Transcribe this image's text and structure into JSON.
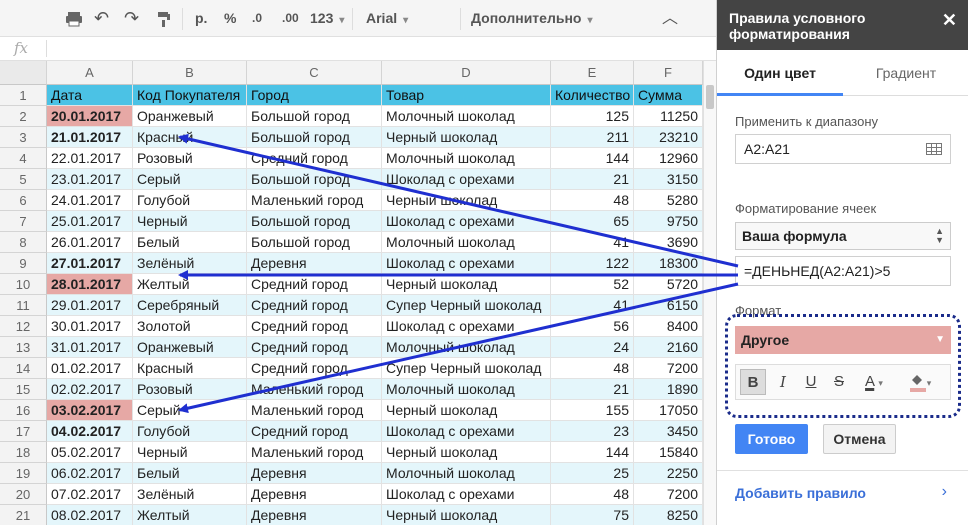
{
  "toolbar": {
    "currency": "р.",
    "percent": "%",
    "dec_less": ".0",
    "dec_more": ".00",
    "number_format": "123",
    "font": "Arial",
    "more": "Дополнительно"
  },
  "formula_bar": {
    "fx": "fx"
  },
  "columns": [
    "A",
    "B",
    "C",
    "D",
    "E",
    "F"
  ],
  "rows": [
    {
      "n": "1",
      "c": [
        "Дата",
        "Код Покупателя",
        "Город",
        "Товар",
        "Количество",
        "Сумма"
      ]
    },
    {
      "n": "2",
      "c": [
        "20.01.2017",
        "Оранжевый",
        "Большой город",
        "Молочный шоколад",
        "125",
        "11250"
      ],
      "hl": true
    },
    {
      "n": "3",
      "c": [
        "21.01.2017",
        "Красный",
        "Большой город",
        "Черный шоколад",
        "211",
        "23210"
      ],
      "hl": true
    },
    {
      "n": "4",
      "c": [
        "22.01.2017",
        "Розовый",
        "Средний город",
        "Молочный шоколад",
        "144",
        "12960"
      ]
    },
    {
      "n": "5",
      "c": [
        "23.01.2017",
        "Серый",
        "Большой город",
        "Шоколад с орехами",
        "21",
        "3150"
      ]
    },
    {
      "n": "6",
      "c": [
        "24.01.2017",
        "Голубой",
        "Маленький город",
        "Черный шоколад",
        "48",
        "5280"
      ]
    },
    {
      "n": "7",
      "c": [
        "25.01.2017",
        "Черный",
        "Большой город",
        "Шоколад с орехами",
        "65",
        "9750"
      ]
    },
    {
      "n": "8",
      "c": [
        "26.01.2017",
        "Белый",
        "Большой город",
        "Молочный шоколад",
        "41",
        "3690"
      ]
    },
    {
      "n": "9",
      "c": [
        "27.01.2017",
        "Зелёный",
        "Деревня",
        "Шоколад с орехами",
        "122",
        "18300"
      ],
      "hl": true
    },
    {
      "n": "10",
      "c": [
        "28.01.2017",
        "Желтый",
        "Средний город",
        "Черный шоколад",
        "52",
        "5720"
      ],
      "hl": true
    },
    {
      "n": "11",
      "c": [
        "29.01.2017",
        "Серебряный",
        "Средний город",
        "Супер Черный шоколад",
        "41",
        "6150"
      ]
    },
    {
      "n": "12",
      "c": [
        "30.01.2017",
        "Золотой",
        "Средний город",
        "Шоколад с орехами",
        "56",
        "8400"
      ]
    },
    {
      "n": "13",
      "c": [
        "31.01.2017",
        "Оранжевый",
        "Средний город",
        "Молочный шоколад",
        "24",
        "2160"
      ]
    },
    {
      "n": "14",
      "c": [
        "01.02.2017",
        "Красный",
        "Средний город",
        "Супер Черный шоколад",
        "48",
        "7200"
      ]
    },
    {
      "n": "15",
      "c": [
        "02.02.2017",
        "Розовый",
        "Маленький город",
        "Молочный шоколад",
        "21",
        "1890"
      ]
    },
    {
      "n": "16",
      "c": [
        "03.02.2017",
        "Серый",
        "Маленький город",
        "Черный шоколад",
        "155",
        "17050"
      ],
      "hl": true
    },
    {
      "n": "17",
      "c": [
        "04.02.2017",
        "Голубой",
        "Средний город",
        "Шоколад с орехами",
        "23",
        "3450"
      ],
      "hl": true
    },
    {
      "n": "18",
      "c": [
        "05.02.2017",
        "Черный",
        "Маленький город",
        "Черный шоколад",
        "144",
        "15840"
      ]
    },
    {
      "n": "19",
      "c": [
        "06.02.2017",
        "Белый",
        "Деревня",
        "Молочный шоколад",
        "25",
        "2250"
      ]
    },
    {
      "n": "20",
      "c": [
        "07.02.2017",
        "Зелёный",
        "Деревня",
        "Шоколад с орехами",
        "48",
        "7200"
      ]
    },
    {
      "n": "21",
      "c": [
        "08.02.2017",
        "Желтый",
        "Деревня",
        "Черный шоколад",
        "75",
        "8250"
      ]
    }
  ],
  "panel": {
    "title": "Правила условного форматирования",
    "close": "✕",
    "tab_single": "Один цвет",
    "tab_gradient": "Градиент",
    "range_label": "Применить к диапазону",
    "range_value": "A2:A21",
    "cond_label": "Форматирование ячеек",
    "cond_value": "Ваша формула",
    "formula_value": "=ДЕНЬНЕД(A2:A21)>5",
    "format_label": "Формат",
    "format_value": "Другое",
    "done": "Готово",
    "cancel": "Отмена",
    "add_rule": "Добавить правило"
  },
  "colors": {
    "highlight": "#e6a8a5",
    "header_band": "#4bc2e5",
    "alt_band": "#e4f6fb",
    "arrow": "#1f2fd0",
    "accent": "#4285f4"
  }
}
